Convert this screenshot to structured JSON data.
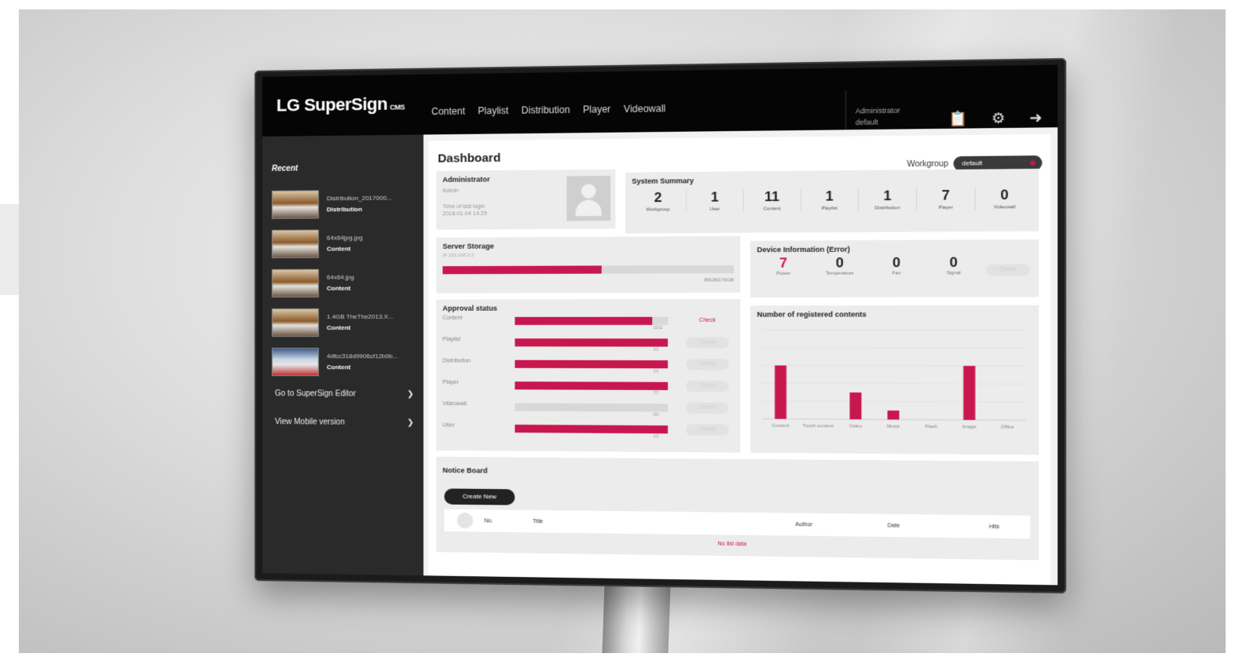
{
  "app": {
    "logo": "LG SuperSign",
    "logo_suffix": "CMS"
  },
  "nav": [
    "Content",
    "Playlist",
    "Distribution",
    "Player",
    "Videowall"
  ],
  "user": {
    "name": "Administrator",
    "workgroup": "default"
  },
  "icons": {
    "docs": "clipboard-icon",
    "settings": "gear-icon",
    "logout": "logout-icon"
  },
  "sidebar": {
    "recent_title": "Recent",
    "items": [
      {
        "name": "Distribution_2017000...",
        "type": "Distribution"
      },
      {
        "name": "64x64jpg.jpg",
        "type": "Content"
      },
      {
        "name": "64x64.jpg",
        "type": "Content"
      },
      {
        "name": "1.4GB TheThe2013.X...",
        "type": "Content"
      },
      {
        "name": "4dfcc318d9906cf12b0b...",
        "type": "Content"
      }
    ],
    "links": [
      "Go to SuperSign Editor",
      "View Mobile version"
    ]
  },
  "dashboard": {
    "title": "Dashboard",
    "workgroup_label": "Workgroup",
    "workgroup_value": "default",
    "admin": {
      "title": "Administrator",
      "role": "Admin",
      "last_login_label": "Time of last login",
      "last_login": "2018-01-04 14:29"
    },
    "summary": {
      "title": "System Summary",
      "items": [
        {
          "value": "2",
          "label": "Workgroup"
        },
        {
          "value": "1",
          "label": "User"
        },
        {
          "value": "11",
          "label": "Content"
        },
        {
          "value": "1",
          "label": "Playlist"
        },
        {
          "value": "1",
          "label": "Distribution"
        },
        {
          "value": "7",
          "label": "Player"
        },
        {
          "value": "0",
          "label": "Videowall"
        }
      ]
    },
    "storage": {
      "title": "Server Storage",
      "ip": "IP 192.168.0.3",
      "used_fraction": 0.55,
      "capacity": "89GB/170GB"
    },
    "device": {
      "title": "Device Information (Error)",
      "items": [
        {
          "value": "7",
          "label": "Power",
          "error": true
        },
        {
          "value": "0",
          "label": "Temperature",
          "error": false
        },
        {
          "value": "0",
          "label": "Fan",
          "error": false
        },
        {
          "value": "0",
          "label": "Signal",
          "error": false
        }
      ],
      "check": "Check"
    },
    "approval": {
      "title": "Approval status",
      "check_label": "Check",
      "rows": [
        {
          "label": "Content",
          "fraction": 0.9,
          "count": "10/11",
          "active": true
        },
        {
          "label": "Playlist",
          "fraction": 1.0,
          "count": "1/1",
          "active": false
        },
        {
          "label": "Distribution",
          "fraction": 1.0,
          "count": "1/1",
          "active": false
        },
        {
          "label": "Player",
          "fraction": 1.0,
          "count": "7/7",
          "active": false
        },
        {
          "label": "Videowall",
          "fraction": 0.0,
          "count": "0/0",
          "active": false
        },
        {
          "label": "User",
          "fraction": 1.0,
          "count": "1/1",
          "active": false
        }
      ]
    },
    "notice": {
      "title": "Notice Board",
      "create_label": "Create New",
      "columns": [
        "No.",
        "Title",
        "Author",
        "Date",
        "Hits"
      ],
      "empty": "No list data"
    }
  },
  "chart_data": {
    "type": "bar",
    "title": "Number of registered contents",
    "categories": [
      "Content",
      "Touch content",
      "Video",
      "Music",
      "Flash",
      "Image",
      "Office"
    ],
    "values": [
      6,
      0,
      3,
      1,
      0,
      6,
      0
    ],
    "ylim": [
      0,
      10
    ],
    "grid": true,
    "color": "#c8174f"
  },
  "colors": {
    "accent": "#c8174f",
    "topbar": "#050505",
    "sidebar": "#2a2a2a"
  }
}
